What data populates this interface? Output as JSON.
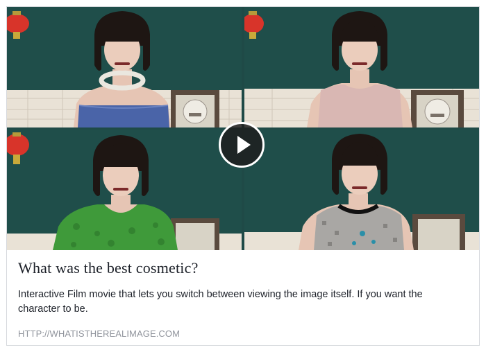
{
  "link_card": {
    "title": "What was the best cosmetic?",
    "description": "Interactive Film movie that lets you switch between viewing the image itself. If you want the character to be.",
    "url": "HTTP://WHATISTHEREALIMAGE.COM"
  },
  "media": {
    "play_icon": "play-icon",
    "tiles": [
      {
        "dress": "blue strapless dress with silver collar",
        "dress_color": "#4a64a8"
      },
      {
        "dress": "pale pink sleeveless dress",
        "dress_color": "#d9b7b3"
      },
      {
        "dress": "green lace dress",
        "dress_color": "#3f9a3a"
      },
      {
        "dress": "grey patterned dress with black collar",
        "dress_color": "#a9a7a4"
      }
    ],
    "colors": {
      "wall": "#1f4e4a",
      "tile_wall": "#e9e2d6",
      "tile_stripe": "#c98b7e",
      "lantern": "#d8342a"
    }
  }
}
